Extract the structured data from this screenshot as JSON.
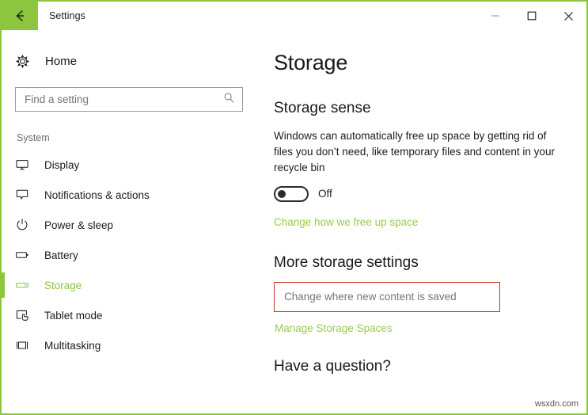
{
  "window": {
    "titlebar_title": "Settings",
    "back_icon": "back-arrow-icon",
    "minimize_icon": "minimize-icon",
    "maximize_icon": "maximize-icon",
    "close_icon": "close-icon",
    "accent_color": "#8CC63F",
    "border_color": "#8CC63F"
  },
  "sidebar": {
    "home": {
      "label": "Home",
      "icon": "gear-icon"
    },
    "search": {
      "placeholder": "Find a setting",
      "value": "",
      "icon": "search-icon"
    },
    "category": "System",
    "items": [
      {
        "label": "Display",
        "icon": "monitor-icon",
        "selected": false
      },
      {
        "label": "Notifications & actions",
        "icon": "speech-bubble-icon",
        "selected": false
      },
      {
        "label": "Power & sleep",
        "icon": "power-icon",
        "selected": false
      },
      {
        "label": "Battery",
        "icon": "battery-icon",
        "selected": false
      },
      {
        "label": "Storage",
        "icon": "drive-icon",
        "selected": true
      },
      {
        "label": "Tablet mode",
        "icon": "tablet-hand-icon",
        "selected": false
      },
      {
        "label": "Multitasking",
        "icon": "multitasking-icon",
        "selected": false
      }
    ]
  },
  "main": {
    "page_title": "Storage",
    "storage_sense": {
      "heading": "Storage sense",
      "description": "Windows can automatically free up space by getting rid of files you don’t need, like temporary files and content in your recycle bin",
      "toggle_state": "Off",
      "toggle_on": false,
      "free_space_link": "Change how we free up space"
    },
    "more_storage": {
      "heading": "More storage settings",
      "change_content_link": "Change where new content is saved",
      "manage_spaces_link": "Manage Storage Spaces",
      "highlight_color": "#C0392B"
    },
    "question_heading": "Have a question?"
  },
  "watermark": "wsxdn.com",
  "colors": {
    "accent_green": "#8CC63F",
    "link_green": "#9ACB4E",
    "highlight_red": "#C0392B",
    "text_primary": "#1a1a1a",
    "text_muted": "#767676"
  }
}
